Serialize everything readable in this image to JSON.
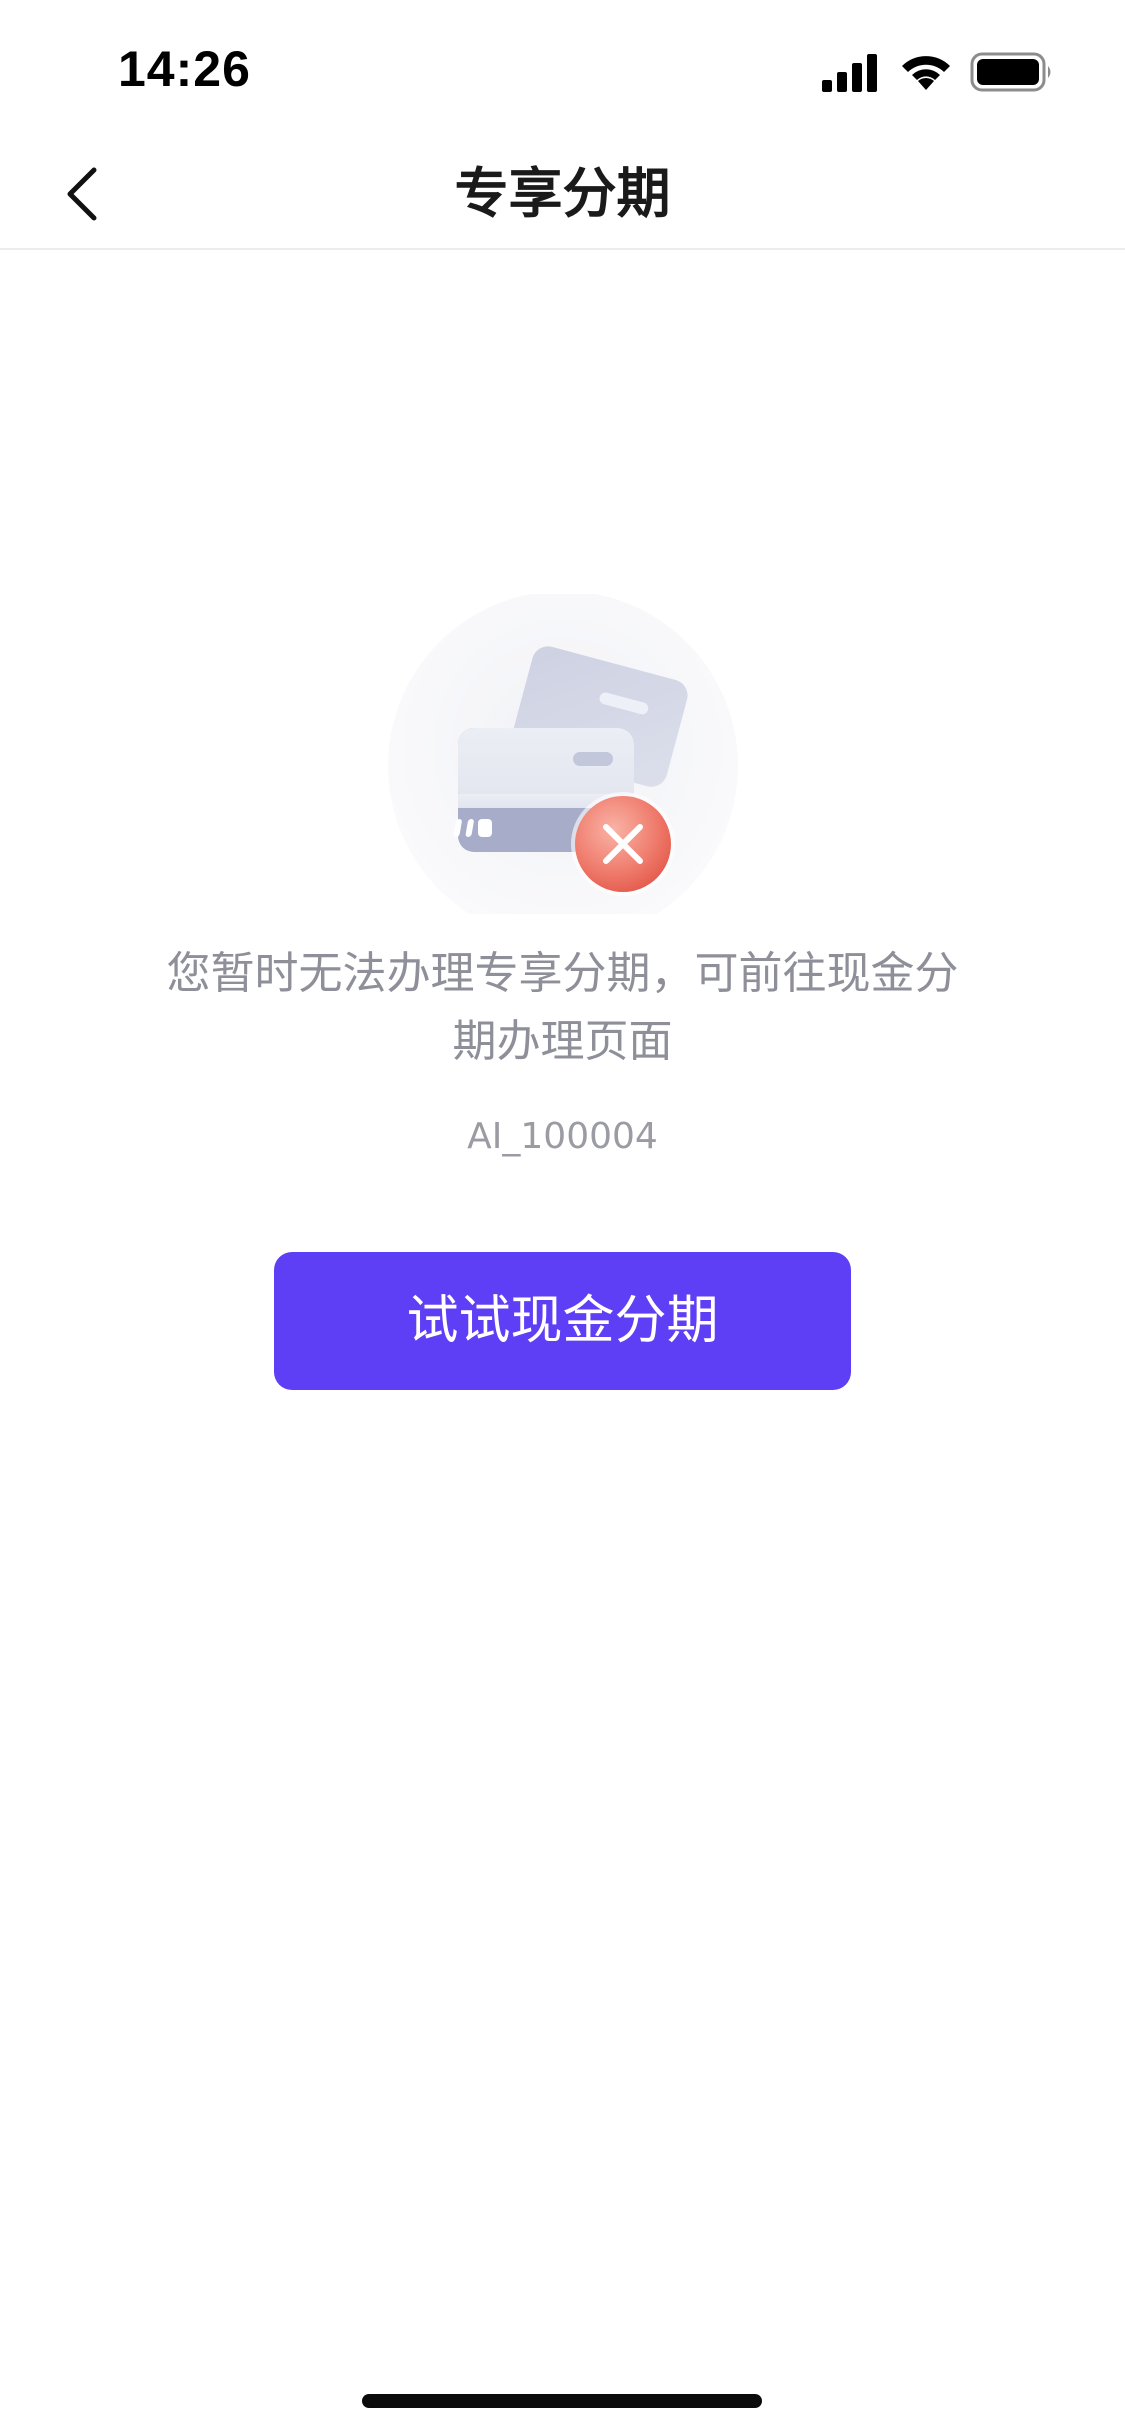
{
  "status_bar": {
    "time": "14:26",
    "icons": [
      "signal-icon",
      "wifi-icon",
      "battery-icon"
    ]
  },
  "nav": {
    "title": "专享分期",
    "back_icon": "chevron-left-icon"
  },
  "main": {
    "illustration_icon": "card-error-icon",
    "message": "您暂时无法办理专享分期，可前往现金分期办理页面",
    "error_code": "AI_100004",
    "cta_label": "试试现金分期"
  },
  "colors": {
    "accent": "#5e3ff5",
    "error": "#f06a5e",
    "muted_text": "#8e8f98"
  }
}
